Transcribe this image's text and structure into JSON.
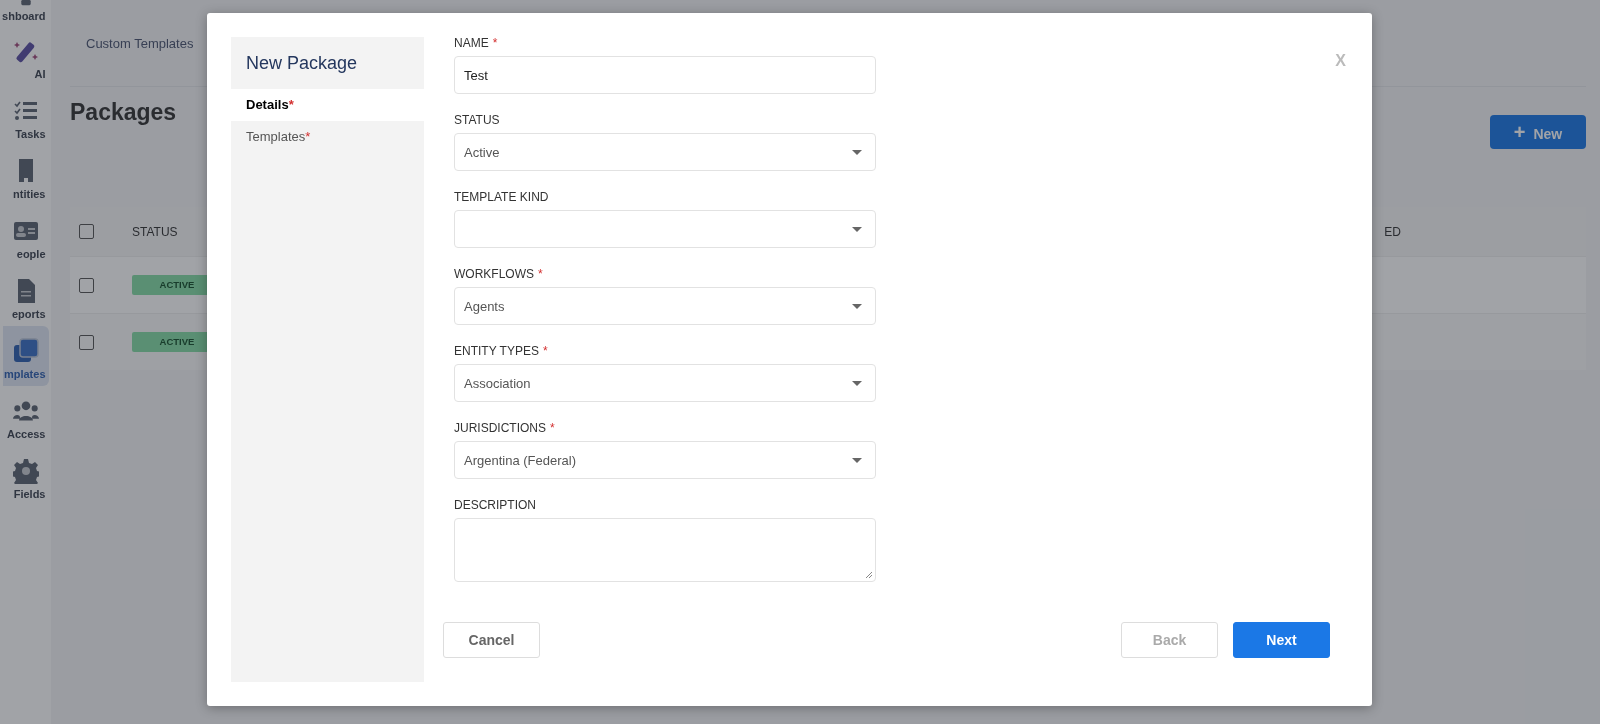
{
  "sidebar": {
    "items": [
      {
        "label": "shboard",
        "selected": false
      },
      {
        "label": "AI",
        "selected": false
      },
      {
        "label": "Tasks",
        "selected": false
      },
      {
        "label": "ntities",
        "selected": false
      },
      {
        "label": "eople",
        "selected": false
      },
      {
        "label": "eports",
        "selected": false
      },
      {
        "label": "mplates",
        "selected": true
      },
      {
        "label": "Access",
        "selected": false
      },
      {
        "label": "Fields",
        "selected": false
      }
    ]
  },
  "page": {
    "tab": "Custom Templates",
    "title": "Packages",
    "new_button": {
      "icon": "+",
      "label": "New"
    },
    "table": {
      "columns": [
        "STATUS",
        "ED"
      ],
      "all_checked": false,
      "rows": [
        {
          "checked": false,
          "status": "ACTIVE"
        },
        {
          "checked": false,
          "status": "ACTIVE"
        }
      ]
    }
  },
  "modal": {
    "title": "New Package",
    "close": "X",
    "steps": [
      {
        "label": "Details",
        "required_mark": "*",
        "selected": true
      },
      {
        "label": "Templates",
        "required_mark": "*",
        "selected": false
      }
    ],
    "fields": [
      {
        "kind": "text",
        "label": "NAME",
        "required_mark": "*",
        "value": "Test"
      },
      {
        "kind": "select",
        "label": "STATUS",
        "value": "Active"
      },
      {
        "kind": "select",
        "label": "TEMPLATE KIND"
      },
      {
        "kind": "select",
        "label": "WORKFLOWS",
        "required_mark": "*",
        "value": "Agents"
      },
      {
        "kind": "select",
        "label": "ENTITY TYPES",
        "required_mark": "*",
        "value": "Association"
      },
      {
        "kind": "select",
        "label": "JURISDICTIONS",
        "required_mark": "*",
        "value": "Argentina (Federal)"
      },
      {
        "kind": "textarea",
        "label": "DESCRIPTION"
      }
    ],
    "buttons": [
      {
        "kind": "cancel",
        "label": "Cancel",
        "disabled": false
      },
      {
        "kind": "back",
        "label": "Back",
        "disabled": true
      },
      {
        "kind": "next",
        "label": "Next",
        "disabled": false
      }
    ]
  }
}
